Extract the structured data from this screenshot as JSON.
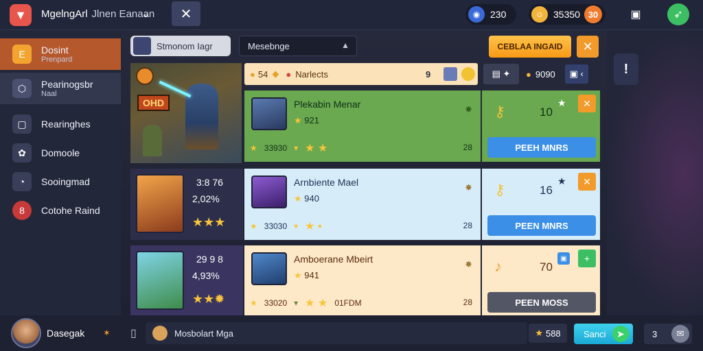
{
  "header": {
    "app_title": "MgelngArl",
    "app_subtitle": "Jlnen Eanaan",
    "close_symbol": "✕",
    "gems": "230",
    "coins": "35350",
    "coins_plus": "30"
  },
  "sidebar": {
    "items": [
      {
        "label": "Dosint",
        "sublabel": "Prenpard"
      },
      {
        "label": "Pearinogsbr",
        "sublabel": "Naal"
      },
      {
        "label": "Rearinghes",
        "sublabel": ""
      },
      {
        "label": "Domoole",
        "sublabel": ""
      },
      {
        "label": "Sooingmad",
        "sublabel": ""
      },
      {
        "label": "Cotohe Raind",
        "sublabel": ""
      }
    ]
  },
  "toolbar": {
    "player_chip": "Stmonom Iagr",
    "search_value": "Mesebnge",
    "orange_button": "CEBLAA INGAID",
    "x_symbol": "✕",
    "side_square_label": "!"
  },
  "filter_bar": {
    "count": "54",
    "label": "Narlects",
    "badge_number": "9",
    "right_value": "9090"
  },
  "hero_banner": {
    "badge": "OHD"
  },
  "rows": [
    {
      "title": "Plekabin Menar",
      "stars_value": "921",
      "cost": "33930",
      "extra": "",
      "number": "28",
      "reward_count": "10",
      "claim_label": "PEEH MNRS",
      "left_stat_1": "",
      "left_stat_2": ""
    },
    {
      "title": "Arnbiente Mael",
      "stars_value": "940",
      "cost": "33030",
      "extra": "",
      "number": "28",
      "reward_count": "16",
      "claim_label": "PEEN MNRS",
      "left_stat_1": "3:8 76",
      "left_stat_2": "2,02%"
    },
    {
      "title": "Amboerane Mbeirt",
      "stars_value": "941",
      "cost": "33020",
      "extra": "01FDM",
      "number": "28",
      "reward_count": "70",
      "claim_label": "PEEN MOSS",
      "left_stat_1": "29 9 8",
      "left_stat_2": "4,93%"
    }
  ],
  "footer": {
    "player_name": "Dasegak",
    "chat_text": "Mosbolart Mga",
    "star_value": "588",
    "send_label": "Sanci",
    "count": "3"
  },
  "colors": {
    "row1": "#6aa94f",
    "row2": "#d6edf9",
    "row3": "#fde9c7",
    "claim_blue": "#3b8fe6",
    "claim_gray": "#535765"
  }
}
